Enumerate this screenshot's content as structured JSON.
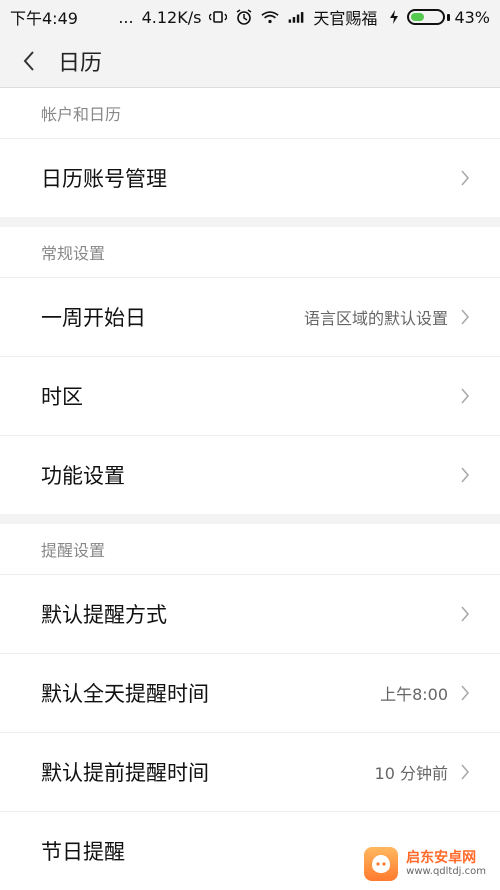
{
  "status": {
    "time": "下午4:49",
    "dots": "...",
    "speed": "4.12K/s",
    "carrier": "天官赐福",
    "battery": "43%",
    "battery_level": 0.43
  },
  "header": {
    "title": "日历"
  },
  "sections": [
    {
      "header": "帐户和日历",
      "rows": [
        {
          "label": "日历账号管理",
          "value": ""
        }
      ]
    },
    {
      "header": "常规设置",
      "rows": [
        {
          "label": "一周开始日",
          "value": "语言区域的默认设置"
        },
        {
          "label": "时区",
          "value": ""
        },
        {
          "label": "功能设置",
          "value": ""
        }
      ]
    },
    {
      "header": "提醒设置",
      "rows": [
        {
          "label": "默认提醒方式",
          "value": ""
        },
        {
          "label": "默认全天提醒时间",
          "value": "上午8:00"
        },
        {
          "label": "默认提前提醒时间",
          "value": "10 分钟前"
        },
        {
          "label": "节日提醒",
          "value": ""
        }
      ]
    }
  ],
  "watermark": {
    "title": "启东安卓网",
    "url": "www.qdltdj.com"
  }
}
